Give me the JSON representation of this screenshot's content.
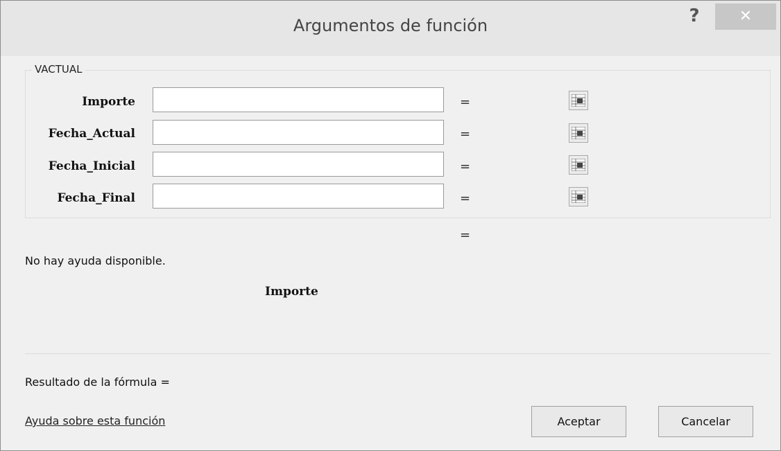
{
  "window": {
    "title": "Argumentos de función",
    "help_glyph": "?",
    "close_glyph": "✕"
  },
  "function": {
    "name": "VACTUAL",
    "arguments": [
      {
        "label": "Importe",
        "value": "",
        "equals": "="
      },
      {
        "label": "Fecha_Actual",
        "value": "",
        "equals": "="
      },
      {
        "label": "Fecha_Inicial",
        "value": "",
        "equals": "="
      },
      {
        "label": "Fecha_Final",
        "value": "",
        "equals": "="
      }
    ],
    "result_equals": "=",
    "help_text": "No hay ayuda disponible.",
    "current_argument": "Importe"
  },
  "footer": {
    "result_label": "Resultado de la fórmula =",
    "help_link": "Ayuda sobre esta función",
    "ok_label": "Aceptar",
    "cancel_label": "Cancelar"
  },
  "icons": {
    "collapse": "range-select-icon"
  }
}
